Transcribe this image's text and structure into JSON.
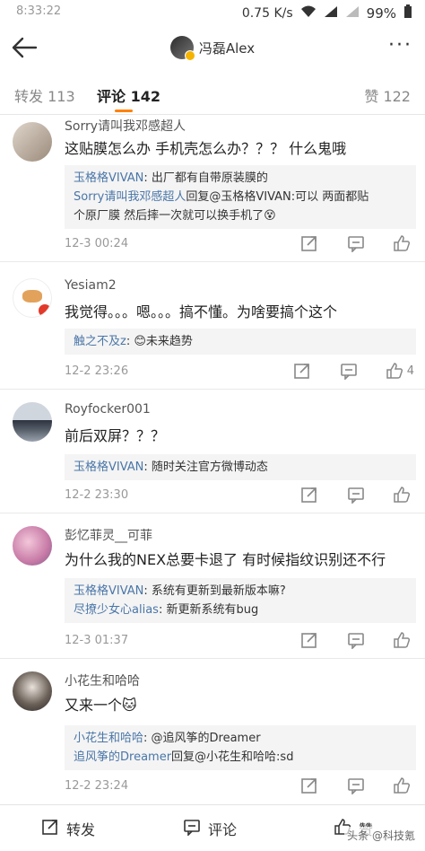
{
  "statusbar": {
    "time": "8:33:22",
    "speed": "0.75 K/s",
    "battery": "99%"
  },
  "header": {
    "user": "冯磊Alex"
  },
  "tabs": {
    "repost": "转发 113",
    "comments": "评论 142",
    "likes": "赞 122"
  },
  "comments": [
    {
      "user": "Sorry请叫我邓感超人",
      "text": "这贴膜怎么办 手机壳怎么办？？？ 什么鬼哦",
      "replies": [
        {
          "name": "玉格格VIVAN",
          "text": ": 出厂都有自带原装膜的"
        },
        {
          "name": "Sorry请叫我邓感超人",
          "text": "回复@玉格格VIVAN:可以 两面都贴"
        },
        {
          "name": "",
          "text": "个原厂膜 然后摔一次就可以换手机了😵"
        }
      ],
      "time": "12-3 00:24",
      "likes": ""
    },
    {
      "user": "Yesiam2",
      "text": "我觉得。。。嗯。。。搞不懂。为啥要搞个这个",
      "replies": [
        {
          "name": "触之不及z",
          "text": ": 😊未来趋势"
        }
      ],
      "time": "12-2 23:26",
      "likes": "4"
    },
    {
      "user": "Royfocker001",
      "text": "前后双屏？？？",
      "replies": [
        {
          "name": "玉格格VIVAN",
          "text": ": 随时关注官方微博动态"
        }
      ],
      "time": "12-2 23:30",
      "likes": ""
    },
    {
      "user": "彭忆菲灵__可菲",
      "text": "为什么我的NEX总要卡退了 有时候指纹识别还不行",
      "replies": [
        {
          "name": "玉格格VIVAN",
          "text": ": 系统有更新到最新版本嘛?"
        },
        {
          "name": "尽撩少女心alias",
          "text": ": 新更新系统有bug"
        }
      ],
      "time": "12-3 01:37",
      "likes": ""
    },
    {
      "user": "小花生和哈哈",
      "text": "又来一个🐱",
      "replies": [
        {
          "name": "小花生和哈哈",
          "text": ": @追风筝的Dreamer"
        },
        {
          "name": "追风筝的Dreamer",
          "text": "回复@小花生和哈哈:sd"
        }
      ],
      "time": "12-2 23:24",
      "likes": ""
    }
  ],
  "bottombar": {
    "repost": "转发",
    "comment": "评论",
    "like": "赞"
  },
  "watermark": "头条 @科技氪",
  "colors": {
    "accent": "#ff8200",
    "link": "#4a76a8"
  }
}
